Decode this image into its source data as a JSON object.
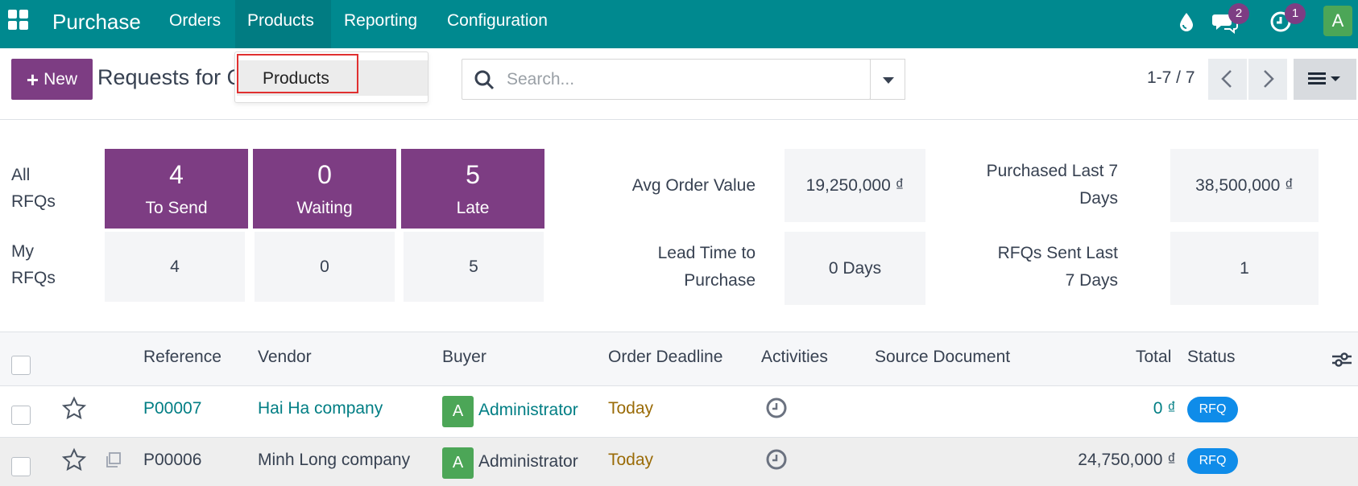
{
  "navbar": {
    "app_name": "Purchase",
    "menu": [
      "Orders",
      "Products",
      "Reporting",
      "Configuration"
    ],
    "active_menu": "Products",
    "messages_badge": "2",
    "activities_badge": "1",
    "user_initial": "A",
    "brand_color": "#00898f",
    "icons": [
      "apps-grid-icon",
      "droplet-icon",
      "chat-icon",
      "clock-icon"
    ]
  },
  "control_panel": {
    "new_button": "New",
    "title": "Requests for Quotation",
    "dropdown_item": "Products",
    "search_placeholder": "Search...",
    "pager": "1-7 / 7"
  },
  "dashboard": {
    "all_rfqs_label": "All RFQs",
    "my_rfqs_label": "My RFQs",
    "tiles": [
      {
        "value": "4",
        "label": "To Send"
      },
      {
        "value": "0",
        "label": "Waiting"
      },
      {
        "value": "5",
        "label": "Late"
      }
    ],
    "my": [
      "4",
      "0",
      "5"
    ],
    "kpis": {
      "avg_order_value_label": "Avg Order Value",
      "avg_order_value": "19,250,000 ₫",
      "lead_time_label": "Lead Time to Purchase",
      "lead_time": "0 Days",
      "purchased_label": "Purchased Last 7 Days",
      "purchased": "38,500,000 ₫",
      "rfqs_sent_label": "RFQs Sent Last 7 Days",
      "rfqs_sent": "1"
    }
  },
  "table": {
    "columns": [
      "Reference",
      "Vendor",
      "Buyer",
      "Order Deadline",
      "Activities",
      "Source Document",
      "Total",
      "Status"
    ],
    "rows": [
      {
        "reference": "P00007",
        "vendor": "Hai Ha company",
        "buyer_initial": "A",
        "buyer": "Administrator",
        "deadline": "Today",
        "total": "0 ₫",
        "status": "RFQ"
      },
      {
        "reference": "P00006",
        "vendor": "Minh Long company",
        "buyer_initial": "A",
        "buyer": "Administrator",
        "deadline": "Today",
        "total": "24,750,000 ₫",
        "status": "RFQ"
      }
    ]
  }
}
